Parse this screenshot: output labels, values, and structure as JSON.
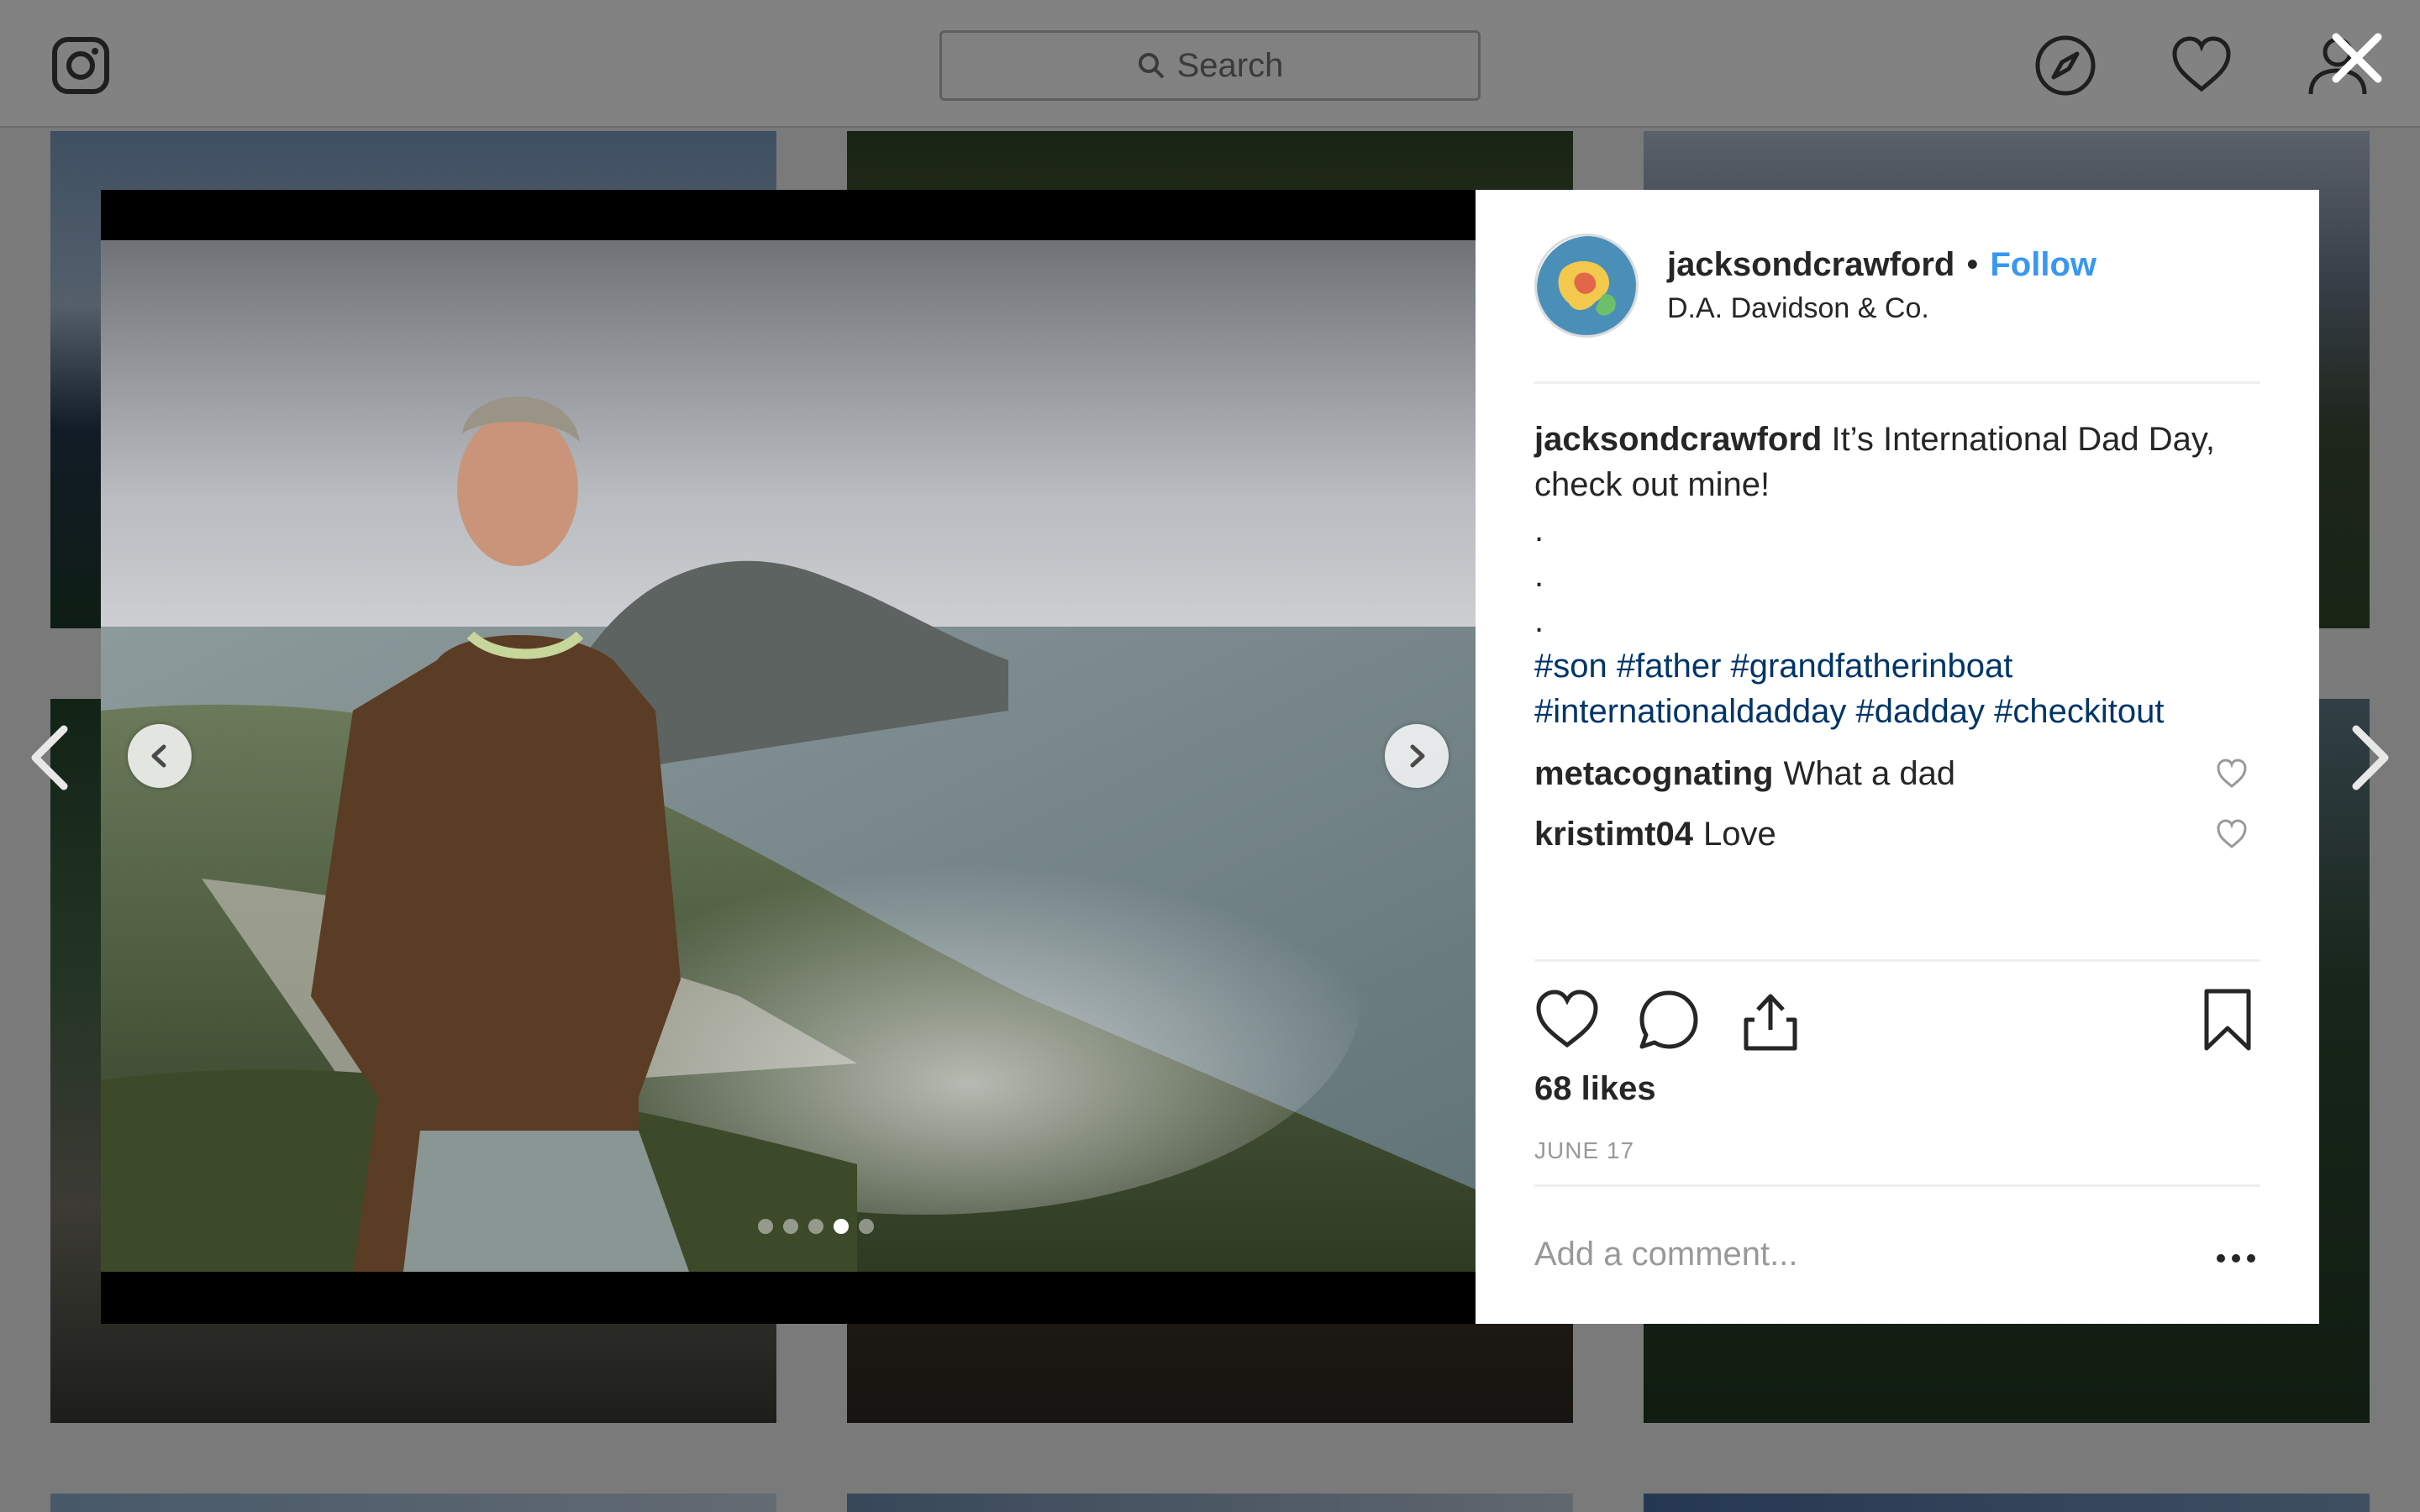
{
  "topbar": {
    "search_placeholder": "Search",
    "icons": [
      "instagram-logo-icon",
      "search-icon",
      "compass-icon",
      "heart-icon",
      "user-icon"
    ]
  },
  "overlay": {
    "close_icon": "close-icon",
    "prev_icon": "chevron-left-icon",
    "next_icon": "chevron-right-icon"
  },
  "post": {
    "carousel": {
      "total": 5,
      "active_index": 3
    },
    "header": {
      "username": "jacksondcrawford",
      "separator": "•",
      "follow_label": "Follow",
      "location": "D.A. Davidson & Co."
    },
    "caption": {
      "username": "jacksondcrawford",
      "text": "It’s International Dad Day, check out mine!",
      "dots": [
        ".",
        ".",
        "."
      ],
      "hashtags_line1": "#son #father #grandfatherinboat",
      "hashtags_line2": "#internationaldadday #dadday #checkitout"
    },
    "comments": [
      {
        "username": "metacognating",
        "text": "What a dad"
      },
      {
        "username": "kristimt04",
        "text": "Love"
      }
    ],
    "likes_label": "68 likes",
    "date_label": "JUNE 17",
    "add_comment_placeholder": "Add a comment...",
    "colors": {
      "follow": "#3897f0",
      "hashtag": "#003569",
      "muted": "#999999"
    }
  }
}
